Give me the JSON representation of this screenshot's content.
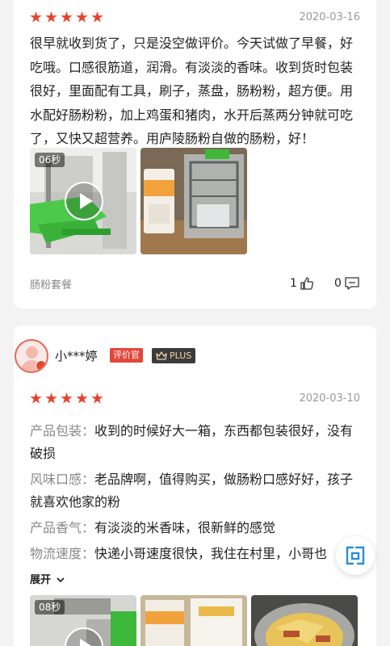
{
  "review1": {
    "rating": 5,
    "date": "2020-03-16",
    "text": "很早就收到货了，只是没空做评价。今天试做了早餐，好吃哦。口感很筋道，润滑。有淡淡的香味。收到货时包装很好，里面配有工具，刷子，蒸盘，肠粉粉，超方便。用水配好肠粉粉，加上鸡蛋和猪肉，水开后蒸两分钟就可吃了，又快又超营养。用庐陵肠粉自做的肠粉，好！",
    "video_duration": "06秒",
    "product_spec": "肠粉套餐",
    "likes": "1",
    "comments": "0"
  },
  "review2": {
    "username": "小***婷",
    "badge_label": "评价官",
    "plus_label": "PLUS",
    "rating": 5,
    "date": "2020-03-10",
    "rows": [
      {
        "key": "产品包装：",
        "value": "收到的时候好大一箱，东西都包装很好，没有破损"
      },
      {
        "key": "风味口感：",
        "value": "老品牌啊，值得购买，做肠粉口感好好，孩子就喜欢他家的粉"
      },
      {
        "key": "产品香气：",
        "value": "有淡淡的米香味，很新鲜的感觉"
      },
      {
        "key": "物流速度：",
        "value": "快递小哥速度很快，我住在村里，小哥也"
      }
    ],
    "expand_label": "展开",
    "video_duration": "08秒"
  },
  "float_button_label": "问",
  "colors": {
    "accent": "#e4463a",
    "star": "#e8402c",
    "muted": "#888888",
    "date": "#999999",
    "plus_text": "#f2d29c"
  }
}
